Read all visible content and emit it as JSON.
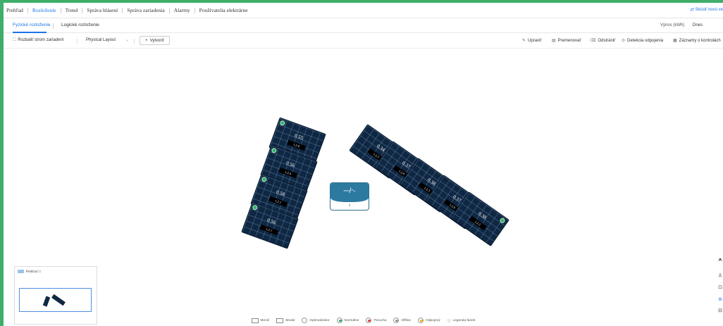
{
  "nav": {
    "items": [
      "Prehľad",
      "Rozloženie",
      "Trend",
      "Správa hlásení",
      "Správa zariadenia",
      "Alarmy",
      "Používatelia elektrárne"
    ],
    "active": "Rozloženie",
    "new_version": "⇄ Skúsiť novú ve"
  },
  "tabs": {
    "physical": "Fyzické rozloženie",
    "logical": "Logické rozloženie",
    "yield_label": "Výnos (kWh)",
    "date": "Dnes"
  },
  "toolbar": {
    "expand_tree": "Rozbaliť strom zariadení",
    "layout_select": "Physical Layout",
    "create": "Vytvoriť",
    "edit": "Upraviť",
    "rename": "Premenovať",
    "remove": "Odstrániť",
    "detect": "Detekcia odpojenia",
    "records": "Záznamy o kontrolách"
  },
  "panels": [
    {
      "value": "0.55",
      "id": "1.2.6"
    },
    {
      "value": "0.56",
      "id": "1.2.4"
    },
    {
      "value": "0.58",
      "id": "1.2.1"
    },
    {
      "value": "0.56",
      "id": "1.2.7"
    },
    {
      "value": "0.34",
      "id": "1.2.5"
    },
    {
      "value": "0.37",
      "id": "1.2.8"
    },
    {
      "value": "0.38",
      "id": "1.2.3"
    },
    {
      "value": "0.37",
      "id": "1.2.9"
    },
    {
      "value": "0.38",
      "id": "1.2.2"
    }
  ],
  "inverter": {
    "symbol": "⎓/∿",
    "number": "1"
  },
  "overview": {
    "title": "Prehľad"
  },
  "legend": {
    "inverter": "Menič",
    "module": "Modul",
    "optimizer": "Optimalizátor",
    "normal": "Normálne",
    "fault": "Porucha",
    "offline": "Offline",
    "disconnected": "Odpojený",
    "color_legend": "Legenda farieb"
  },
  "colors": {
    "accent": "#1a73e8",
    "frame": "#3fae6a",
    "panel": "#0f2742",
    "inverter": "#2d7aa0",
    "normal": "#2fb36b",
    "fault": "#e0443e"
  }
}
